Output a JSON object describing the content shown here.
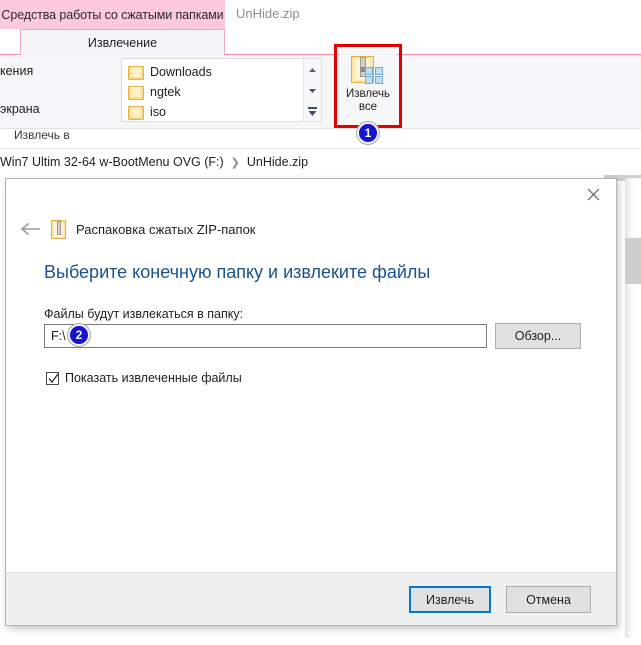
{
  "explorer": {
    "contextual_tab": "Средства работы со сжатыми папками",
    "file_tab": "UnHide.zip",
    "ribbon_tab": "Извлечение",
    "group_caption": "Извлечь в",
    "left_labels": [
      "кения",
      "экрана"
    ],
    "gallery_items": [
      {
        "label": "Downloads",
        "icon": "folder-icon"
      },
      {
        "label": "ngtek",
        "icon": "folder-icon"
      },
      {
        "label": "iso",
        "icon": "folder-icon"
      }
    ],
    "scroll_icons": [
      "scroll-up-icon",
      "scroll-down-icon",
      "scroll-more-icon"
    ],
    "extract_all": {
      "label_line1": "Извлечь",
      "label_line2": "все",
      "icon": "extract-all-zip-icon"
    },
    "breadcrumb": {
      "drive": "Win7 Ultim 32-64 w-BootMenu OVG (F:)",
      "separator": "❯",
      "current": "UnHide.zip"
    }
  },
  "dialog": {
    "title": "Распаковка сжатых ZIP-папок",
    "title_icon": "zip-folder-icon",
    "back_icon": "back-arrow-icon",
    "close_icon": "close-icon",
    "heading": "Выберите конечную папку и извлеките файлы",
    "field_label": "Файлы будут извлекаться в папку:",
    "path_value": "F:\\",
    "path_placeholder": "",
    "browse_label": "Обзор...",
    "checkbox": {
      "label": "Показать извлеченные файлы",
      "checked": true
    },
    "buttons": {
      "primary": "Извлечь",
      "secondary": "Отмена"
    }
  },
  "annotations": {
    "badges": [
      {
        "id": "1",
        "text": "1"
      },
      {
        "id": "2",
        "text": "2"
      }
    ],
    "highlight_color": "#e50000",
    "badge_color": "#1414d2"
  },
  "colors": {
    "contextual_tab_bg": "#fbc8dd",
    "ribbon_accent": "#f58ab6",
    "heading_blue": "#16538f",
    "focus_blue": "#0078d7"
  }
}
